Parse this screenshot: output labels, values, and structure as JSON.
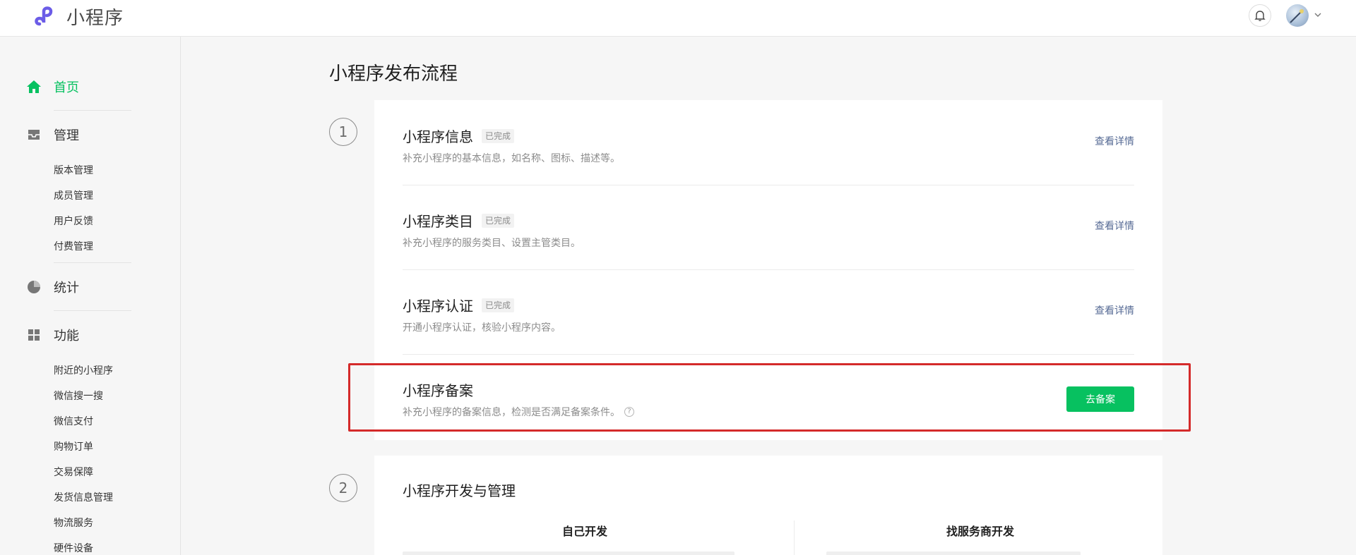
{
  "app": {
    "title": "小程序"
  },
  "header": {
    "icons": [
      "bell-icon",
      "avatar",
      "chevron-down-icon"
    ]
  },
  "sidebar": {
    "home": {
      "label": "首页",
      "icon": "home-icon"
    },
    "manage": {
      "label": "管理",
      "icon": "inbox-icon",
      "items": [
        "版本管理",
        "成员管理",
        "用户反馈",
        "付费管理"
      ]
    },
    "stats": {
      "label": "统计",
      "icon": "pie-chart-icon"
    },
    "features": {
      "label": "功能",
      "icon": "grid-icon",
      "items": [
        "附近的小程序",
        "微信搜一搜",
        "微信支付",
        "购物订单",
        "交易保障",
        "发货信息管理",
        "物流服务",
        "硬件设备"
      ]
    }
  },
  "main": {
    "title": "小程序发布流程",
    "step1": {
      "number": "1",
      "items": [
        {
          "title": "小程序信息",
          "badge": "已完成",
          "desc": "补充小程序的基本信息，如名称、图标、描述等。",
          "link": "查看详情"
        },
        {
          "title": "小程序类目",
          "badge": "已完成",
          "desc": "补充小程序的服务类目、设置主管类目。",
          "link": "查看详情"
        },
        {
          "title": "小程序认证",
          "badge": "已完成",
          "desc": "开通小程序认证，核验小程序内容。",
          "link": "查看详情"
        },
        {
          "title": "小程序备案",
          "desc": "补充小程序的备案信息，检测是否满足备案条件。",
          "help": "?",
          "button": "去备案"
        }
      ]
    },
    "step2": {
      "number": "2",
      "title": "小程序开发与管理",
      "columns": [
        "自己开发",
        "找服务商开发"
      ]
    }
  },
  "colors": {
    "accent": "#07c160",
    "link": "#576b95",
    "highlight": "#d42a2a"
  }
}
